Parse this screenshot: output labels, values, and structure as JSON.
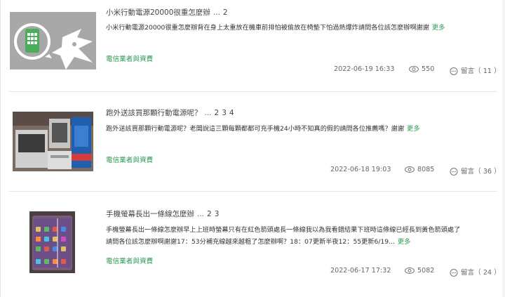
{
  "posts": [
    {
      "title": "小米行動電源20000很重怎麼辦",
      "ellipsis": "...",
      "pages": [
        "2"
      ],
      "excerpt": "小米行動電源20000很重怎麼辦背在身上太重放在機車前排怕被偷放在椅墊下怕過熱爆炸請問各位該怎麼辦啊謝謝",
      "more": "更多",
      "category": "電信業者與資費",
      "date": "2022-06-19 16:33",
      "views": "550",
      "comments": "留言（ 11 ）",
      "thumb_icon": "phone-chat-logo-icon"
    },
    {
      "title": "跑外送該買那顆行動電源呢？",
      "ellipsis": "...",
      "pages": [
        "2",
        "3",
        "4"
      ],
      "excerpt": "跑外送該買那顆行動電源呢？老闆說這三顆每顆都都可充手機24小時不知真的假的請問各位推薦嗎？謝謝",
      "more": "更多",
      "category": "電信業者與資費",
      "date": "2022-06-18 19:03",
      "views": "8085",
      "comments": "留言（ 36 ）",
      "thumb_icon": "power-bank-photo-icon"
    },
    {
      "title": "手機螢幕長出一條線怎麼辦",
      "ellipsis": "...",
      "pages": [
        "2",
        "3"
      ],
      "excerpt_line1": "手機螢幕長出一條線怎麼辦早上上班時螢幕只有在紅色箭頭處長一條線我以為我看錯結果下班時這條線已經長到黃色箭頭處了",
      "excerpt_line2": "請問各位該怎麼辦啊謝謝17：53分補充線越來越粗了怎麼辦啊？18：07更新半夜12：55更新6/19...",
      "more": "更多",
      "category": "電信業者與資費",
      "date": "2022-06-17 17:32",
      "views": "5082",
      "comments": "留言（ 24 ）",
      "thumb_icon": "phone-screen-photo-icon"
    }
  ],
  "colors": {
    "accent_green": "#2e9b55",
    "logo_bg": "#a8a8a8",
    "logo_green": "#4aad5a"
  }
}
